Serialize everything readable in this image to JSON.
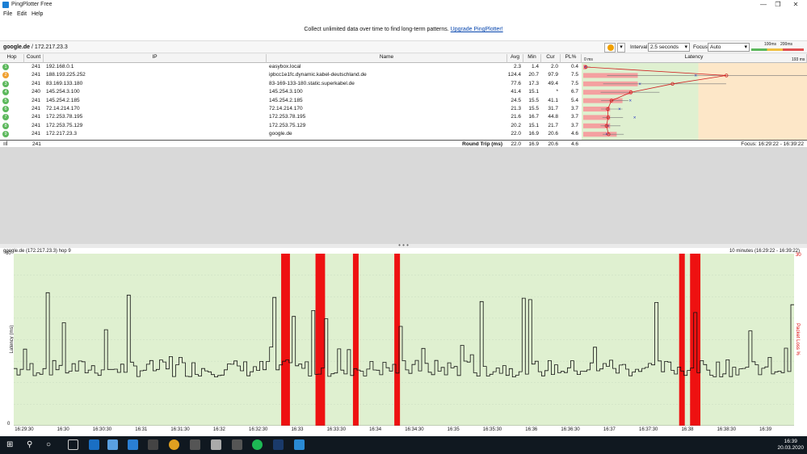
{
  "window": {
    "title": "PingPlotter Free",
    "buttons": [
      "—",
      "❐",
      "✕"
    ]
  },
  "menu": [
    "File",
    "Edit",
    "Help"
  ],
  "promo": {
    "text": "Collect unlimited data over time to find long-term patterns.",
    "link": "Upgrade PingPlotter!"
  },
  "toolbar": {
    "target_name": "google.de",
    "target_ip": "/ 172.217.23.3",
    "interval_label": "Interval",
    "interval_value": "2.5 seconds",
    "focus_label": "Focus",
    "focus_value": "Auto",
    "legend_100": "100ms",
    "legend_200": "200ms"
  },
  "columns": {
    "hop": "Hop",
    "count": "Count",
    "ip": "IP",
    "name": "Name",
    "avg": "Avg",
    "min": "Min",
    "cur": "Cur",
    "pl": "PL%",
    "latency": "Latency",
    "lat_min": "0 ms",
    "lat_max": "193 ms"
  },
  "hops": [
    {
      "hop": "1",
      "count": "241",
      "ip": "192.168.0.1",
      "name": "easybox.local",
      "avg": "2.3",
      "min": "1.4",
      "cur": "2.0",
      "pl": "0.4",
      "color": "#5cb85c",
      "bar": 0.4,
      "avg_v": 2.3
    },
    {
      "hop": "2",
      "count": "241",
      "ip": "188.193.225.252",
      "name": "ipbcc1e1fc.dynamic.kabel-deutschland.de",
      "avg": "124.4",
      "min": "20.7",
      "cur": "97.9",
      "pl": "7.5",
      "color": "#f0a030",
      "bar": 7.5,
      "avg_v": 124.4
    },
    {
      "hop": "3",
      "count": "241",
      "ip": "83.169.133.180",
      "name": "83-169-133-180.static.superkabel.de",
      "avg": "77.6",
      "min": "17.3",
      "cur": "49.4",
      "pl": "7.5",
      "color": "#5cb85c",
      "bar": 7.5,
      "avg_v": 77.6
    },
    {
      "hop": "4",
      "count": "240",
      "ip": "145.254.3.100",
      "name": "145.254.3.100",
      "avg": "41.4",
      "min": "15.1",
      "cur": "*",
      "pl": "6.7",
      "color": "#5cb85c",
      "bar": 6.7,
      "avg_v": 41.4
    },
    {
      "hop": "5",
      "count": "241",
      "ip": "145.254.2.185",
      "name": "145.254.2.185",
      "avg": "24.5",
      "min": "15.5",
      "cur": "41.1",
      "pl": "5.4",
      "color": "#5cb85c",
      "bar": 5.4,
      "avg_v": 24.5
    },
    {
      "hop": "6",
      "count": "241",
      "ip": "72.14.214.170",
      "name": "72.14.214.170",
      "avg": "21.3",
      "min": "15.5",
      "cur": "31.7",
      "pl": "3.7",
      "color": "#5cb85c",
      "bar": 3.7,
      "avg_v": 21.3
    },
    {
      "hop": "7",
      "count": "241",
      "ip": "172.253.78.195",
      "name": "172.253.78.195",
      "avg": "21.6",
      "min": "16.7",
      "cur": "44.8",
      "pl": "3.7",
      "color": "#5cb85c",
      "bar": 3.7,
      "avg_v": 21.6
    },
    {
      "hop": "8",
      "count": "241",
      "ip": "172.253.75.129",
      "name": "172.253.75.129",
      "avg": "20.2",
      "min": "15.1",
      "cur": "21.7",
      "pl": "3.7",
      "color": "#5cb85c",
      "bar": 3.7,
      "avg_v": 20.2
    },
    {
      "hop": "9",
      "count": "241",
      "ip": "172.217.23.3",
      "name": "google.de",
      "avg": "22.0",
      "min": "16.9",
      "cur": "20.6",
      "pl": "4.6",
      "color": "#5cb85c",
      "bar": 4.6,
      "avg_v": 22.0
    }
  ],
  "summary": {
    "count": "241",
    "label": "Round Trip (ms)",
    "avg": "22.0",
    "min": "16.9",
    "cur": "20.6",
    "pl": "4.6",
    "focus": "Focus: 16:29:22 - 16:39:22"
  },
  "graph": {
    "title": "google.de (172.217.23.3) hop 9",
    "range": "10 minutes (16:29:22 - 16:39:22)",
    "ylabel": "Latency (ms)",
    "y2label": "Packet Loss %",
    "ymax": "60",
    "ymin": "0",
    "y2max": "30",
    "xticks": [
      "16:29:30",
      "16:30",
      "16:30:30",
      "16:31",
      "16:31:30",
      "16:32",
      "16:32:30",
      "16:33",
      "16:33:30",
      "16:34",
      "16:34:30",
      "16:35",
      "16:35:30",
      "16:36",
      "16:36:30",
      "16:37",
      "16:37:30",
      "16:38",
      "16:38:30",
      "16:39"
    ]
  },
  "chart_data": {
    "type": "line",
    "title": "google.de (172.217.23.3) hop 9",
    "xlabel": "",
    "ylabel": "Latency (ms)",
    "ylim": [
      0,
      60
    ],
    "loss_minutes": [
      16.83,
      16.87,
      17.27,
      17.32,
      17.75,
      18.28,
      21.93,
      22.07,
      22.13
    ]
  },
  "taskbar": {
    "time": "16:39",
    "date": "20.03.2020"
  }
}
